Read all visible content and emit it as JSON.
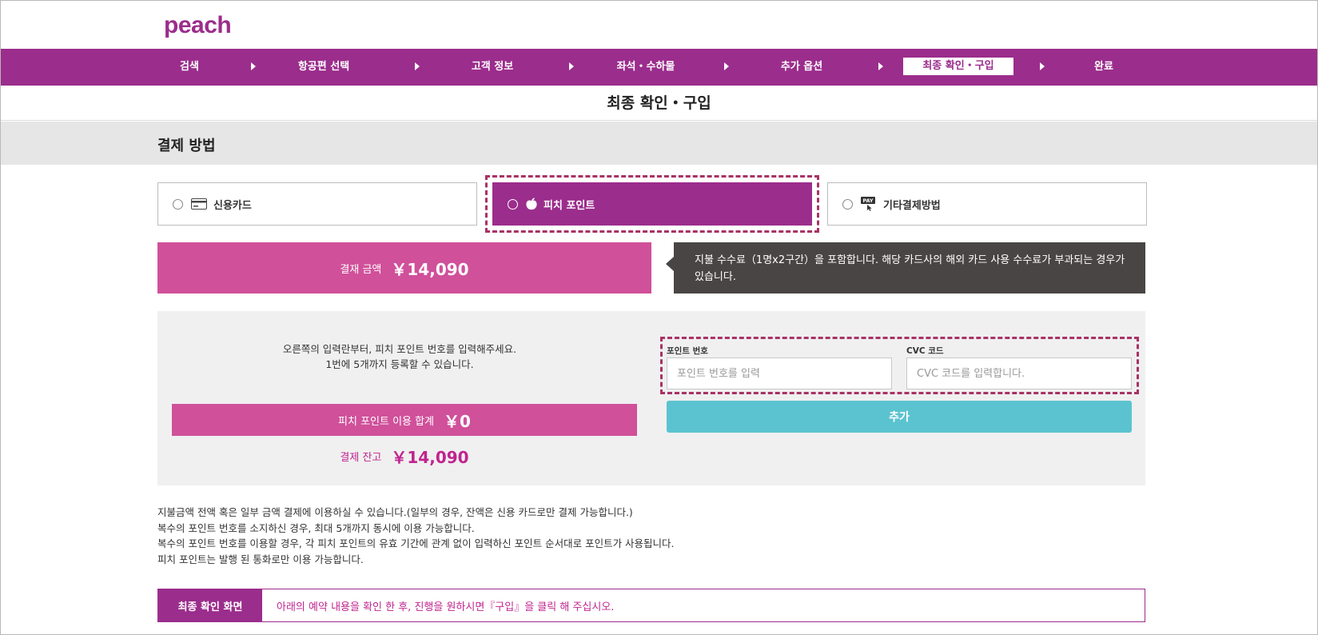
{
  "brand": {
    "logo_text": "peach",
    "color": "#9b2d8c"
  },
  "steps": [
    {
      "label": "검색",
      "active": false
    },
    {
      "label": "항공편 선택",
      "active": false
    },
    {
      "label": "고객 정보",
      "active": false
    },
    {
      "label": "좌석・수하물",
      "active": false
    },
    {
      "label": "추가 옵션",
      "active": false
    },
    {
      "label": "최종 확인・구입",
      "active": true
    },
    {
      "label": "완료",
      "active": false
    }
  ],
  "page_title": "최종 확인・구입",
  "section_title": "결제 방법",
  "payment_tabs": [
    {
      "label": "신용카드",
      "icon": "credit-card-icon",
      "selected": false
    },
    {
      "label": "피치 포인트",
      "icon": "peach-icon",
      "selected": true
    },
    {
      "label": "기타결제방법",
      "icon": "pay-icon",
      "selected": false
    }
  ],
  "pay_icon_text": "PAY",
  "amount": {
    "label": "결재 금액",
    "value": "￥14,090"
  },
  "notice": "지불 수수료（1명x2구간）을 포함합니다. 해당 카드사의 해외 카드 사용 수수료가 부과되는 경우가 있습니다.",
  "points_panel": {
    "instruction_line1": "오른쪽의 입력란부터, 피치 포인트 번호를 입력해주세요.",
    "instruction_line2": "1번에 5개까지 등록할 수 있습니다.",
    "used_total_label": "피치 포인트 이용 합계",
    "used_total_value": "￥0",
    "balance_label": "결제 잔고",
    "balance_value": "￥14,090",
    "point_number_label": "포인트 번호",
    "point_number_placeholder": "포인트 번호를 입력",
    "point_number_value": "",
    "cvc_label": "CVC 코드",
    "cvc_placeholder": "CVC 코드를 입력합니다.",
    "cvc_value": "",
    "add_button": "추가"
  },
  "notes": [
    "지불금액 전액 혹은 일부 금액 결제에 이용하실 수 있습니다.(일부의 경우, 잔액은 신용 카드로만 결제 가능합니다.)",
    "복수의 포인트 번호를 소지하신 경우, 최대 5개까지 동시에 이용 가능합니다.",
    "복수의 포인트 번호를 이용할 경우, 각 피치 포인트의 유효 기간에 관계 없이 입력하신 포인트 순서대로 포인트가 사용됩니다.",
    "피치 포인트는 발행 된 통화로만 이용 가능합니다."
  ],
  "confirm": {
    "title": "최종 확인 화면",
    "text": "아래의 예약 내용을 확인 한 후, 진행을 원하시면『구입』을 클릭 해 주십시오."
  },
  "colors": {
    "primary": "#9b2d8c",
    "pink": "#d0509a",
    "accent_text": "#c0248f",
    "add_button": "#5bc3d0",
    "notice_bg": "#4a4545",
    "dashed_highlight": "#a83264"
  }
}
